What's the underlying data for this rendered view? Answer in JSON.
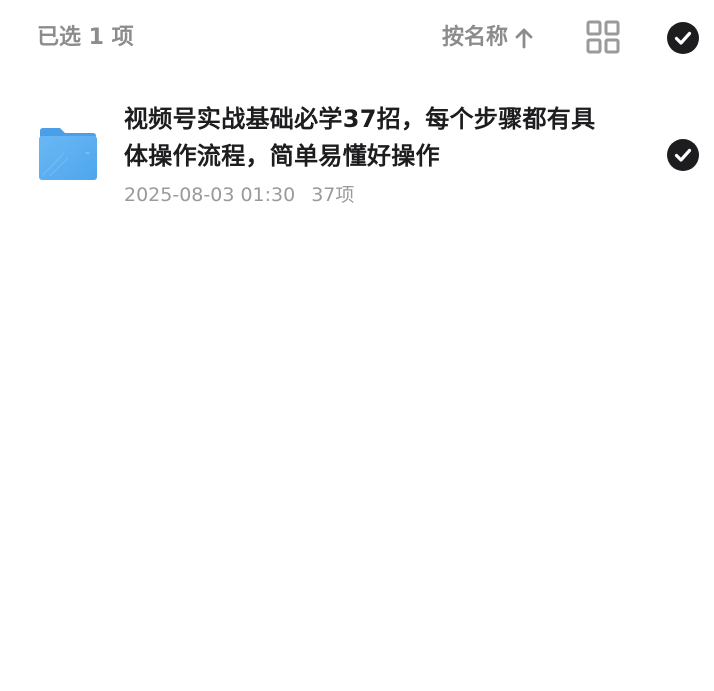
{
  "header": {
    "selection_label": "已选 1 项",
    "sort_label": "按名称",
    "sort_direction_icon": "arrow-up-icon",
    "view_toggle_icon": "grid-view-icon",
    "select_all_icon": "check-circle-icon"
  },
  "files": [
    {
      "icon": "folder-icon",
      "name": "视频号实战基础必学37招，每个步骤都有具体操作流程，简单易懂好操作",
      "date": "2025-08-03 01:30",
      "item_count": "37项",
      "selected": true,
      "select_icon": "check-circle-icon"
    }
  ],
  "colors": {
    "primary_text": "#1d1d1f",
    "secondary_text": "#8c8c8c",
    "meta_text": "#9a9a9a",
    "check_fill": "#1d1d1f",
    "folder_blue": "#5ab0f2"
  }
}
